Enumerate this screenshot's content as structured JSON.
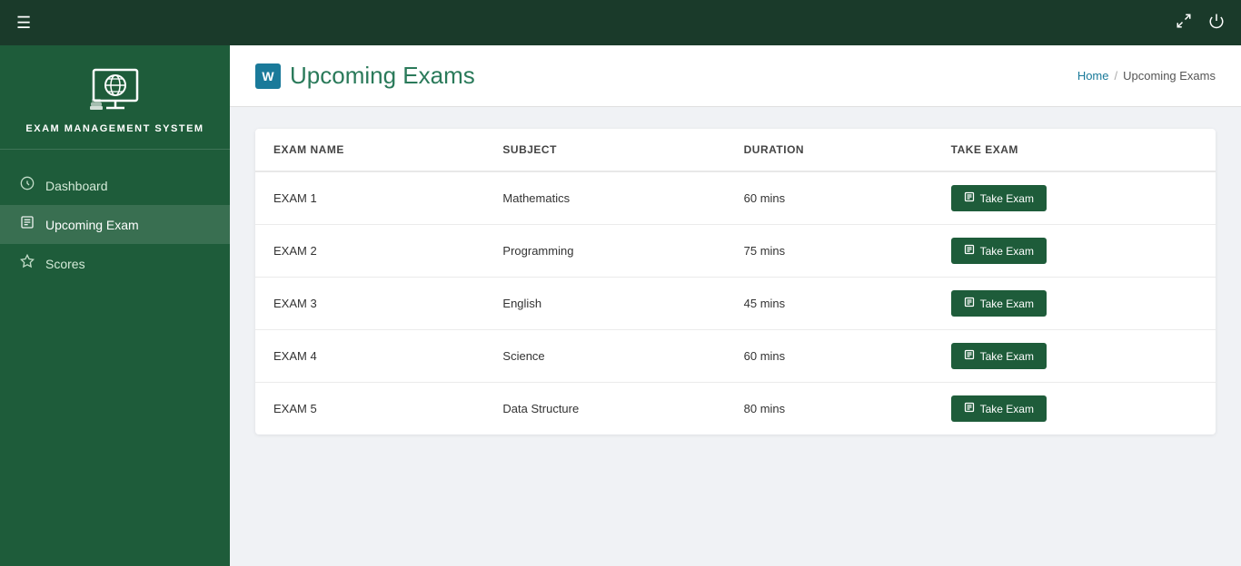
{
  "topbar": {
    "hamburger_label": "☰",
    "fullscreen_icon": "⛶",
    "power_icon": "⏻"
  },
  "sidebar": {
    "logo_title": "Exam Management System",
    "nav_items": [
      {
        "id": "dashboard",
        "label": "Dashboard",
        "icon": "🎨",
        "active": false
      },
      {
        "id": "upcoming-exam",
        "label": "Upcoming Exam",
        "icon": "📋",
        "active": true
      },
      {
        "id": "scores",
        "label": "Scores",
        "icon": "⭐",
        "active": false
      }
    ]
  },
  "page_header": {
    "icon_label": "W",
    "title": "Upcoming Exams",
    "breadcrumb_home": "Home",
    "breadcrumb_sep": "/",
    "breadcrumb_current": "Upcoming Exams"
  },
  "table": {
    "columns": [
      "EXAM NAME",
      "SUBJECT",
      "DURATION",
      "TAKE EXAM"
    ],
    "rows": [
      {
        "exam_name": "EXAM 1",
        "subject": "Mathematics",
        "duration": "60 mins"
      },
      {
        "exam_name": "EXAM 2",
        "subject": "Programming",
        "duration": "75 mins"
      },
      {
        "exam_name": "EXAM 3",
        "subject": "English",
        "duration": "45 mins"
      },
      {
        "exam_name": "EXAM 4",
        "subject": "Science",
        "duration": "60 mins"
      },
      {
        "exam_name": "EXAM 5",
        "subject": "Data Structure",
        "duration": "80 mins"
      }
    ],
    "take_exam_label": "Take Exam"
  },
  "colors": {
    "sidebar_bg": "#1e5c3a",
    "topbar_bg": "#1a3a2a",
    "accent": "#1e5c3a",
    "link": "#1a7a9a"
  }
}
